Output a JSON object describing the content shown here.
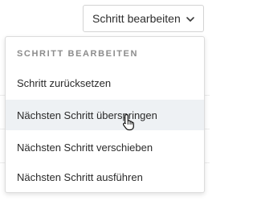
{
  "button": {
    "label": "Schritt bearbeiten",
    "icon": "chevron-down-icon"
  },
  "menu": {
    "header": "SCHRITT BEARBEITEN",
    "items": [
      {
        "label": "Schritt zurücksetzen"
      },
      {
        "label": "Nächsten Schritt überspringen",
        "hovered": true
      },
      {
        "label": "Nächsten Schritt verschieben"
      },
      {
        "label": "Nächsten Schritt ausführen"
      }
    ]
  },
  "cursor": {
    "icon": "hand-pointer-icon"
  },
  "colors": {
    "hover_background": "#eef1f4",
    "header_text": "#8c8c8c",
    "item_text": "#2a2a2a",
    "border": "#d3d3d3"
  }
}
